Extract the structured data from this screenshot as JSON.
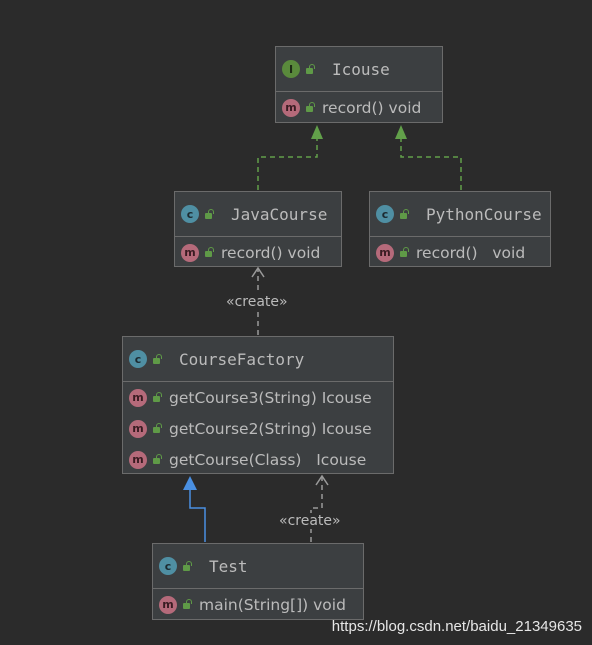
{
  "colors": {
    "background": "#2b2b2b",
    "node_fill": "#3c3f41",
    "node_border": "#6b6b6b",
    "text": "#bbbbbb",
    "implements_arrow": "#62a04a",
    "extends_arrow": "#4a90e2",
    "dependency_arrow": "#9a9a9a"
  },
  "nodes": {
    "icouse": {
      "badge": "I",
      "kind": "interface",
      "name": "Icouse",
      "methods": [
        "record() void"
      ]
    },
    "java_course": {
      "badge": "c",
      "kind": "class",
      "name": "JavaCourse",
      "methods": [
        "record() void"
      ]
    },
    "python_course": {
      "badge": "c",
      "kind": "class",
      "name": "PythonCourse",
      "methods": [
        "record()   void"
      ]
    },
    "course_factory": {
      "badge": "c",
      "kind": "class",
      "name": "CourseFactory",
      "methods": [
        "getCourse3(String) Icouse",
        "getCourse2(String) Icouse",
        "getCourse(Class)   Icouse"
      ]
    },
    "test": {
      "badge": "c",
      "kind": "class",
      "name": "Test",
      "methods": [
        "main(String[]) void"
      ]
    }
  },
  "method_badge": "m",
  "edges": {
    "create_label_1": "«create»",
    "create_label_2": "«create»"
  },
  "watermark": "https://blog.csdn.net/baidu_21349635"
}
